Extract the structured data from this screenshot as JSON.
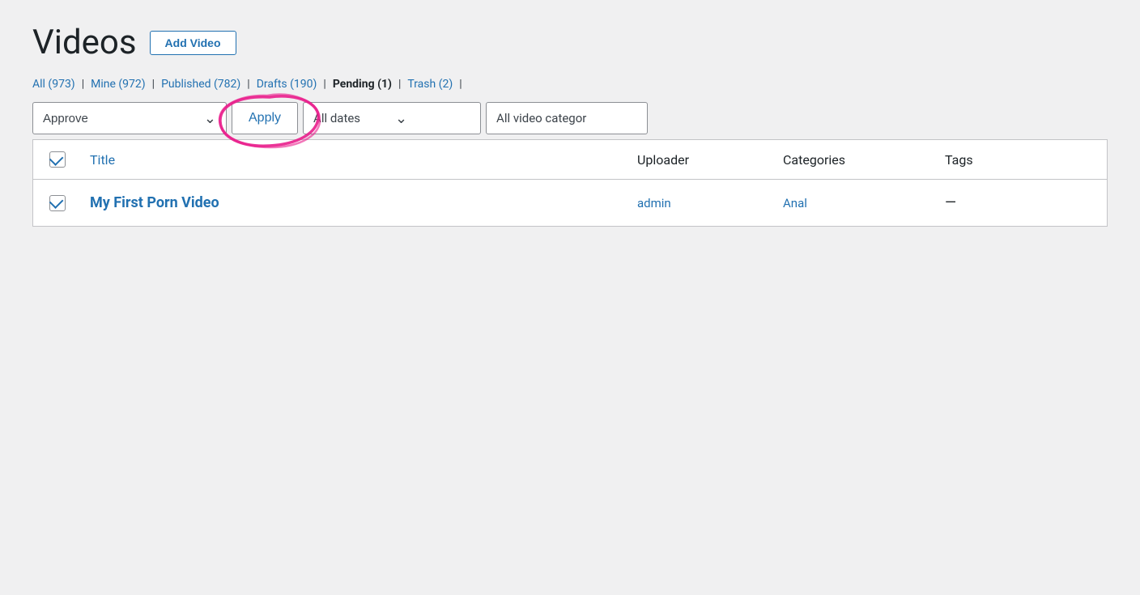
{
  "page": {
    "title": "Videos",
    "add_button": "Add Video"
  },
  "filter_links": [
    {
      "id": "all",
      "label": "All",
      "count": "973",
      "active": false
    },
    {
      "id": "mine",
      "label": "Mine",
      "count": "972",
      "active": false
    },
    {
      "id": "published",
      "label": "Published",
      "count": "782",
      "active": false
    },
    {
      "id": "drafts",
      "label": "Drafts",
      "count": "190",
      "active": false
    },
    {
      "id": "pending",
      "label": "Pending",
      "count": "1",
      "active": true
    },
    {
      "id": "trash",
      "label": "Trash",
      "count": "2",
      "active": false
    }
  ],
  "toolbar": {
    "bulk_action_label": "Approve",
    "apply_label": "Apply",
    "dates_label": "All dates",
    "category_label": "All video categor"
  },
  "table": {
    "headers": {
      "checkbox": "",
      "title": "Title",
      "uploader": "Uploader",
      "categories": "Categories",
      "tags": "Tags"
    },
    "rows": [
      {
        "id": "row1",
        "title": "My First Porn Video",
        "uploader": "admin",
        "categories": "Anal",
        "tags": "—"
      }
    ]
  }
}
